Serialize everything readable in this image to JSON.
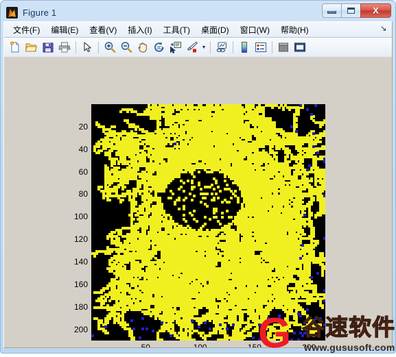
{
  "window": {
    "title": "Figure 1",
    "app_icon": "matlab-logo-icon",
    "controls": {
      "minimize": "minimize-icon",
      "maximize": "maximize-icon",
      "close": "X"
    }
  },
  "menubar": {
    "items": [
      {
        "label": "文件(F)",
        "name": "menu-file"
      },
      {
        "label": "编辑(E)",
        "name": "menu-edit"
      },
      {
        "label": "查看(V)",
        "name": "menu-view"
      },
      {
        "label": "插入(I)",
        "name": "menu-insert"
      },
      {
        "label": "工具(T)",
        "name": "menu-tools"
      },
      {
        "label": "桌面(D)",
        "name": "menu-desktop"
      },
      {
        "label": "窗口(W)",
        "name": "menu-window"
      },
      {
        "label": "帮助(H)",
        "name": "menu-help"
      }
    ],
    "overflow_glyph": "↘"
  },
  "toolbar": {
    "buttons": [
      {
        "name": "new-figure-icon",
        "icon": "new-figure"
      },
      {
        "name": "open-file-icon",
        "icon": "open-folder"
      },
      {
        "name": "save-figure-icon",
        "icon": "save-disk"
      },
      {
        "name": "print-figure-icon",
        "icon": "printer"
      },
      {
        "name": "separator",
        "icon": "separator"
      },
      {
        "name": "edit-plot-icon",
        "icon": "arrow-pointer"
      },
      {
        "name": "separator",
        "icon": "separator"
      },
      {
        "name": "zoom-in-icon",
        "icon": "magnifier-plus"
      },
      {
        "name": "zoom-out-icon",
        "icon": "magnifier-minus"
      },
      {
        "name": "pan-icon",
        "icon": "hand"
      },
      {
        "name": "rotate-3d-icon",
        "icon": "rotate-3d"
      },
      {
        "name": "data-cursor-icon",
        "icon": "data-cursor"
      },
      {
        "name": "brush-icon",
        "icon": "paintbrush"
      },
      {
        "name": "brush-dropdown-icon",
        "icon": "caret-down"
      },
      {
        "name": "separator",
        "icon": "separator"
      },
      {
        "name": "link-data-icon",
        "icon": "link-plot"
      },
      {
        "name": "separator",
        "icon": "separator"
      },
      {
        "name": "colorbar-icon",
        "icon": "colorbar"
      },
      {
        "name": "legend-icon",
        "icon": "legend"
      },
      {
        "name": "separator",
        "icon": "separator"
      },
      {
        "name": "hide-plot-tools-icon",
        "icon": "plot-tools-off"
      },
      {
        "name": "show-plot-tools-icon",
        "icon": "plot-tools-on"
      }
    ]
  },
  "chart_data": {
    "type": "scatter",
    "title": "",
    "xlabel": "",
    "ylabel": "",
    "xlim": [
      0,
      215
    ],
    "ylim": [
      210,
      0
    ],
    "y_inverted": true,
    "grid": false,
    "legend": null,
    "background_color": "#000000",
    "xticks": [
      50,
      100,
      150,
      200
    ],
    "xtick_labels": [
      "50",
      "100",
      "150",
      "200"
    ],
    "yticks": [
      20,
      40,
      60,
      80,
      100,
      120,
      140,
      160,
      180,
      200
    ],
    "ytick_labels": [
      "20",
      "40",
      "60",
      "80",
      "100",
      "120",
      "140",
      "160",
      "180",
      "200"
    ],
    "series": [
      {
        "name": "aggregate-cluster",
        "color": "#f0f020",
        "marker": "pixel",
        "description": "Diffusion-limited aggregation fractal cluster, dendritic branching filling the square domain"
      },
      {
        "name": "free-walkers",
        "color": "#2020c8",
        "marker": "pixel",
        "description": "Sparse unattached random-walk particles scattered mainly at right and bottom edges"
      }
    ],
    "notes": "MATLAB image() render of a 2D DLA lattice simulation; yellow = frozen aggregate sites, dark blue = wandering particles, black = empty lattice"
  },
  "watermark": {
    "logo_letter": "G",
    "text": "谷速软件",
    "url": "www.gususoft.com",
    "color": "#ee1c25"
  }
}
